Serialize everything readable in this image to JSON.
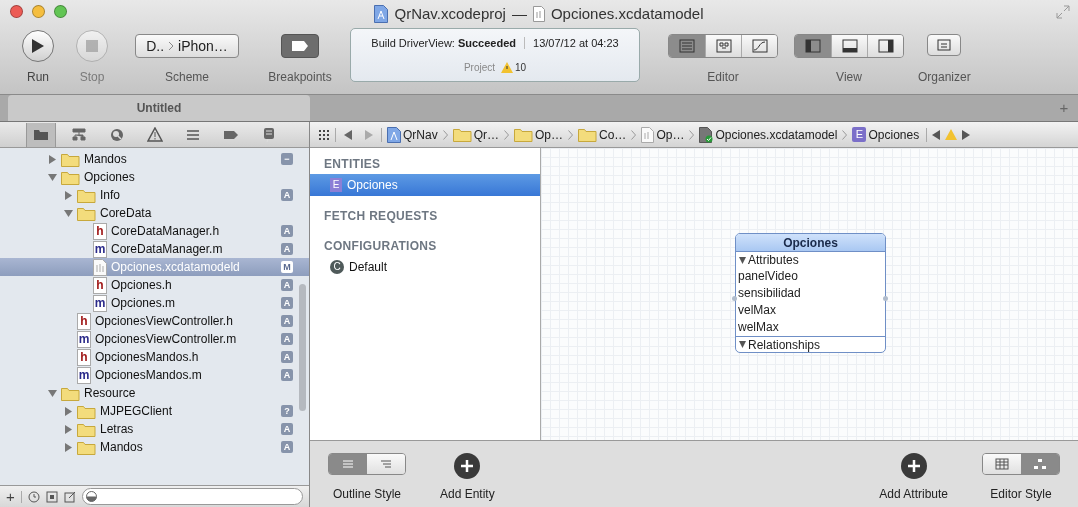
{
  "window": {
    "title_project": "QrNav.xcodeproj",
    "title_separator": "—",
    "title_document": "Opciones.xcdatamodel"
  },
  "toolbar": {
    "run": {
      "label": "Run",
      "disabled": false
    },
    "stop": {
      "label": "Stop",
      "disabled": true
    },
    "scheme": {
      "target": "D..",
      "device": "iPhon…",
      "label": "Scheme"
    },
    "breakpoints": {
      "label": "Breakpoints"
    },
    "activity": {
      "status": "Build DriverView: **Succeeded**",
      "time": "13/07/12 at 04:23",
      "project": "Project",
      "warnings": "10"
    },
    "editor": {
      "label": "Editor",
      "segments": [
        {
          "selected": true
        },
        {
          "selected": false
        },
        {
          "selected": false
        }
      ]
    },
    "view": {
      "label": "View",
      "segments": [
        {
          "selected": true
        },
        {
          "selected": false
        },
        {
          "selected": false
        }
      ]
    },
    "organizer": {
      "label": "Organizer"
    }
  },
  "tabs": [
    {
      "label": "Untitled",
      "selected": true
    }
  ],
  "tab_add": "+",
  "navigator": {
    "selectors": [
      {
        "selected": true
      },
      {
        "selected": false
      },
      {
        "selected": false
      },
      {
        "selected": false
      },
      {
        "selected": false
      },
      {
        "selected": false
      },
      {
        "selected": false
      }
    ],
    "tree": [
      {
        "kind": "folder",
        "label": "Mandos",
        "expanded": false,
        "badge": "−",
        "selected": false
      },
      {
        "kind": "folder",
        "label": "Opciones",
        "expanded": true,
        "selected": false,
        "children": [
          {
            "kind": "folder",
            "label": "Info",
            "expanded": false,
            "badge": "A",
            "selected": false
          },
          {
            "kind": "folder",
            "label": "CoreData",
            "expanded": true,
            "selected": false,
            "children": [
              {
                "kind": "source",
                "glyph": "h",
                "label": "CoreDataManager.h",
                "badge": "A",
                "selected": false
              },
              {
                "kind": "source",
                "glyph": "m",
                "label": "CoreDataManager.m",
                "badge": "A",
                "selected": false
              },
              {
                "kind": "model",
                "label": "Opciones.xcdatamodeld",
                "badge": "M",
                "selected": true
              },
              {
                "kind": "source",
                "glyph": "h",
                "label": "Opciones.h",
                "badge": "A",
                "selected": false
              },
              {
                "kind": "source",
                "glyph": "m",
                "label": "Opciones.m",
                "badge": "A",
                "selected": false
              }
            ]
          },
          {
            "kind": "source",
            "glyph": "h",
            "label": "OpcionesViewController.h",
            "badge": "A",
            "selected": false
          },
          {
            "kind": "source",
            "glyph": "m",
            "label": "OpcionesViewController.m",
            "badge": "A",
            "selected": false
          },
          {
            "kind": "source",
            "glyph": "h",
            "label": "OpcionesMandos.h",
            "badge": "A",
            "selected": false
          },
          {
            "kind": "source",
            "glyph": "m",
            "label": "OpcionesMandos.m",
            "badge": "A",
            "selected": false
          }
        ]
      },
      {
        "kind": "folder",
        "label": "Resource",
        "expanded": true,
        "selected": false,
        "children": [
          {
            "kind": "folder",
            "label": "MJPEGClient",
            "expanded": false,
            "badge": "?",
            "selected": false
          },
          {
            "kind": "folder",
            "label": "Letras",
            "expanded": false,
            "badge": "A",
            "selected": false
          },
          {
            "kind": "folder",
            "label": "Mandos",
            "expanded": false,
            "badge": "A",
            "selected": false
          }
        ]
      }
    ],
    "filter_add": "+"
  },
  "jump_bar": {
    "crumbs": [
      {
        "kind": "project",
        "label": "QrNav"
      },
      {
        "kind": "folder",
        "label": "Qr…"
      },
      {
        "kind": "folder",
        "label": "Op…"
      },
      {
        "kind": "folder",
        "label": "Co…"
      },
      {
        "kind": "document",
        "label": "Op…"
      },
      {
        "kind": "model",
        "label": "Opciones.xcdatamodel"
      },
      {
        "kind": "entity",
        "glyph": "E",
        "label": "Opciones"
      }
    ]
  },
  "outline": {
    "sections": [
      {
        "title": "ENTITIES",
        "items": [
          {
            "glyph": "E",
            "kind": "entity",
            "label": "Opciones",
            "selected": true
          }
        ]
      },
      {
        "title": "FETCH REQUESTS"
      },
      {
        "title": "CONFIGURATIONS",
        "items": [
          {
            "glyph": "C",
            "kind": "configuration",
            "label": "Default",
            "selected": false
          }
        ]
      }
    ]
  },
  "entity": {
    "name": "Opciones",
    "sections": [
      {
        "title": "Attributes",
        "expanded": true,
        "items": [
          "panelVideo",
          "sensibilidad",
          "velMax",
          "welMax"
        ]
      },
      {
        "title": "Relationships",
        "expanded": true
      }
    ]
  },
  "bottom_bar": {
    "outline_style": {
      "label": "Outline Style",
      "segments": [
        {
          "selected": true
        },
        {
          "selected": false
        }
      ]
    },
    "add_entity": {
      "label": "Add Entity"
    },
    "add_attribute": {
      "label": "Add Attribute"
    },
    "editor_style": {
      "label": "Editor Style",
      "segments": [
        {
          "selected": false
        },
        {
          "selected": true
        }
      ]
    }
  }
}
